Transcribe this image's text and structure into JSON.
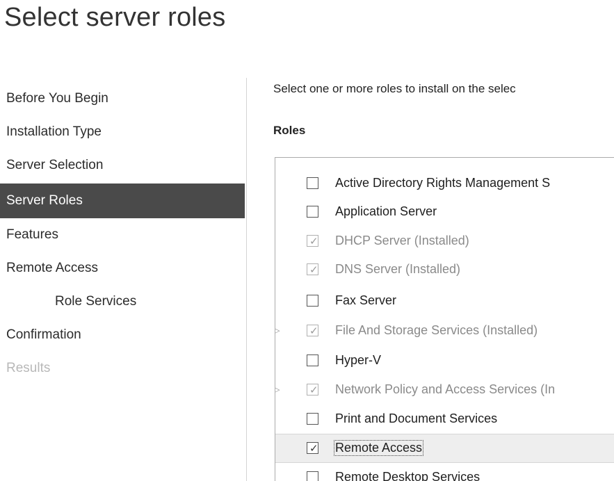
{
  "page": {
    "title": "Select server roles"
  },
  "nav": {
    "items": [
      {
        "label": "Before You Begin",
        "state": "normal"
      },
      {
        "label": "Installation Type",
        "state": "normal"
      },
      {
        "label": "Server Selection",
        "state": "normal"
      },
      {
        "label": "Server Roles",
        "state": "active"
      },
      {
        "label": "Features",
        "state": "normal"
      },
      {
        "label": "Remote Access",
        "state": "normal"
      },
      {
        "label": "Role Services",
        "state": "sub"
      },
      {
        "label": "Confirmation",
        "state": "normal"
      },
      {
        "label": "Results",
        "state": "disabled"
      }
    ]
  },
  "main": {
    "intro": "Select one or more roles to install on the selec",
    "roles_heading": "Roles",
    "roles": [
      {
        "label": "Active Directory Rights Management S",
        "checked": false,
        "installed": false,
        "expandable": false,
        "selected": false
      },
      {
        "label": "Application Server",
        "checked": false,
        "installed": false,
        "expandable": false,
        "selected": false
      },
      {
        "label": "DHCP Server (Installed)",
        "checked": true,
        "installed": true,
        "expandable": false,
        "selected": false
      },
      {
        "label": "DNS Server (Installed)",
        "checked": true,
        "installed": true,
        "expandable": false,
        "selected": false
      },
      {
        "label": "Fax Server",
        "checked": false,
        "installed": false,
        "expandable": false,
        "selected": false
      },
      {
        "label": "File And Storage Services (Installed)",
        "checked": true,
        "installed": true,
        "expandable": true,
        "selected": false
      },
      {
        "label": "Hyper-V",
        "checked": false,
        "installed": false,
        "expandable": false,
        "selected": false
      },
      {
        "label": "Network Policy and Access Services (In",
        "checked": true,
        "installed": true,
        "expandable": true,
        "selected": false
      },
      {
        "label": "Print and Document Services",
        "checked": false,
        "installed": false,
        "expandable": false,
        "selected": false
      },
      {
        "label": "Remote Access",
        "checked": true,
        "installed": false,
        "expandable": false,
        "selected": true
      },
      {
        "label": "Remote Desktop Services",
        "checked": false,
        "installed": false,
        "expandable": false,
        "selected": false
      }
    ]
  },
  "icons": {
    "expander": "expand-triangle-icon",
    "check": "checkmark-icon"
  },
  "colors": {
    "nav_active_bg": "#4a4a4a",
    "selected_row_bg": "#eeeeee"
  }
}
